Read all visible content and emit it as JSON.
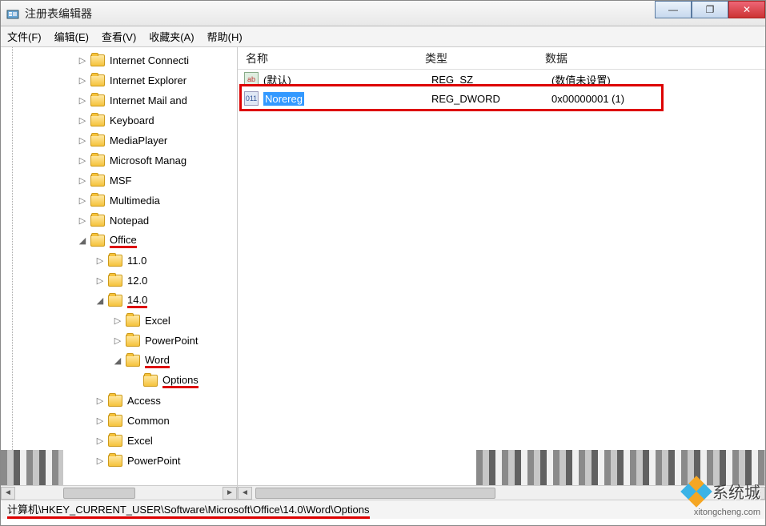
{
  "window": {
    "title": "注册表编辑器"
  },
  "menu": {
    "file": "文件(F)",
    "edit": "编辑(E)",
    "view": "查看(V)",
    "favorites": "收藏夹(A)",
    "help": "帮助(H)"
  },
  "tree": {
    "items": [
      {
        "indent": 96,
        "exp": "▷",
        "label": "Internet Connecti"
      },
      {
        "indent": 96,
        "exp": "▷",
        "label": "Internet Explorer"
      },
      {
        "indent": 96,
        "exp": "▷",
        "label": "Internet Mail and"
      },
      {
        "indent": 96,
        "exp": "▷",
        "label": "Keyboard"
      },
      {
        "indent": 96,
        "exp": "▷",
        "label": "MediaPlayer"
      },
      {
        "indent": 96,
        "exp": "▷",
        "label": "Microsoft Manag"
      },
      {
        "indent": 96,
        "exp": "▷",
        "label": "MSF"
      },
      {
        "indent": 96,
        "exp": "▷",
        "label": "Multimedia"
      },
      {
        "indent": 96,
        "exp": "▷",
        "label": "Notepad"
      },
      {
        "indent": 96,
        "exp": "◢",
        "label": "Office",
        "ul": true
      },
      {
        "indent": 118,
        "exp": "▷",
        "label": "11.0"
      },
      {
        "indent": 118,
        "exp": "▷",
        "label": "12.0"
      },
      {
        "indent": 118,
        "exp": "◢",
        "label": "14.0",
        "ul": true
      },
      {
        "indent": 140,
        "exp": "▷",
        "label": "Excel"
      },
      {
        "indent": 140,
        "exp": "▷",
        "label": "PowerPoint"
      },
      {
        "indent": 140,
        "exp": "◢",
        "label": "Word",
        "ul": true
      },
      {
        "indent": 162,
        "exp": "",
        "label": "Options",
        "ul": true
      },
      {
        "indent": 118,
        "exp": "▷",
        "label": "Access"
      },
      {
        "indent": 118,
        "exp": "▷",
        "label": "Common"
      },
      {
        "indent": 118,
        "exp": "▷",
        "label": "Excel"
      },
      {
        "indent": 118,
        "exp": "▷",
        "label": "PowerPoint"
      }
    ]
  },
  "list": {
    "headers": {
      "name": "名称",
      "type": "类型",
      "data": "数据"
    },
    "rows": [
      {
        "icon": "str",
        "name": "(默认)",
        "type": "REG_SZ",
        "data": "(数值未设置)"
      },
      {
        "icon": "bin",
        "name": "Norereg",
        "type": "REG_DWORD",
        "data": "0x00000001 (1)",
        "selected": true
      }
    ]
  },
  "status": {
    "path": "计算机\\HKEY_CURRENT_USER\\Software\\Microsoft\\Office\\14.0\\Word\\Options"
  },
  "watermark": {
    "brand": "系统城",
    "url": "xitongcheng.com"
  },
  "icons": {
    "str_label": "ab",
    "bin_label": "011\n110"
  }
}
